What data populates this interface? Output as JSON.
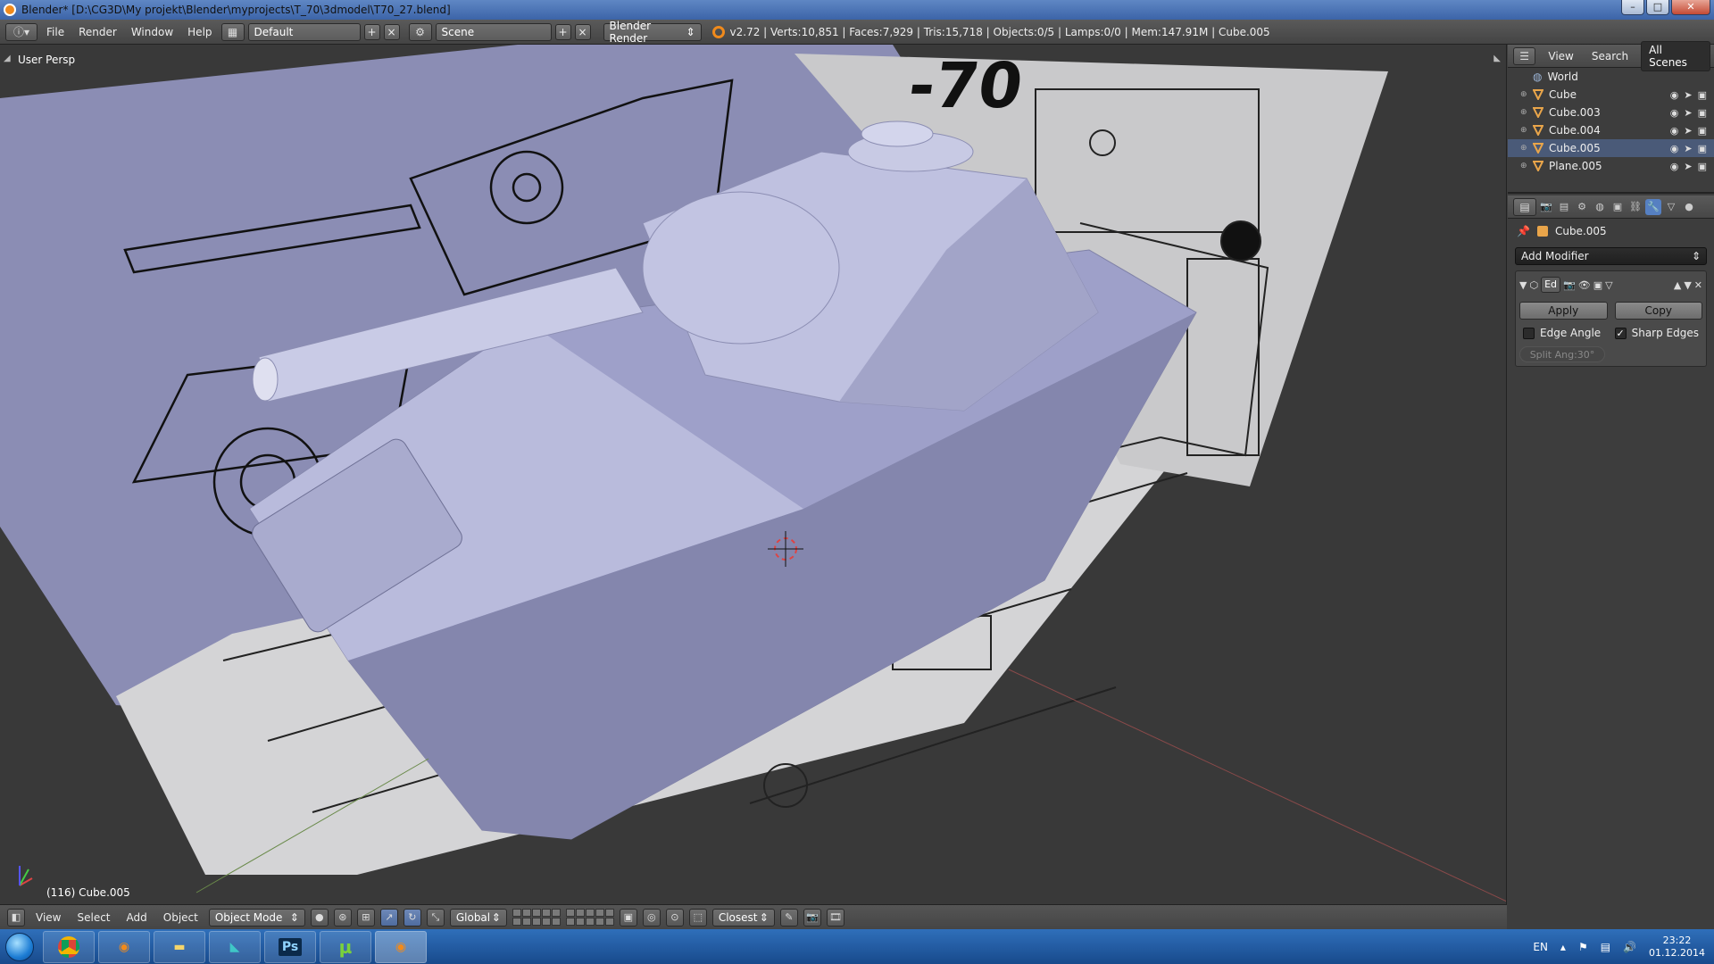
{
  "window": {
    "title": "Blender* [D:\\CG3D\\My projekt\\Blender\\myprojects\\T_70\\3dmodel\\T70_27.blend]",
    "minimize": "–",
    "maximize": "□",
    "close": "✕"
  },
  "header": {
    "menus": [
      "File",
      "Render",
      "Window",
      "Help"
    ],
    "layout": "Default",
    "scene": "Scene",
    "engine": "Blender Render",
    "stats": "v2.72 | Verts:10,851 | Faces:7,929 | Tris:15,718 | Objects:0/5 | Lamps:0/0 | Mem:147.91M | Cube.005"
  },
  "viewport": {
    "view_label": "User Persp",
    "object_label": "(116) Cube.005",
    "blueprint_text": "-70"
  },
  "footer": {
    "menus": [
      "View",
      "Select",
      "Add",
      "Object"
    ],
    "mode": "Object Mode",
    "orientation": "Global",
    "snap": "Closest"
  },
  "outliner": {
    "menus": [
      "View",
      "Search"
    ],
    "display": "All Scenes",
    "items": [
      {
        "name": "World",
        "type": "world"
      },
      {
        "name": "Cube",
        "type": "mesh"
      },
      {
        "name": "Cube.003",
        "type": "mesh"
      },
      {
        "name": "Cube.004",
        "type": "mesh"
      },
      {
        "name": "Cube.005",
        "type": "mesh"
      },
      {
        "name": "Plane.005",
        "type": "mesh"
      }
    ]
  },
  "properties": {
    "context_object": "Cube.005",
    "add_modifier": "Add Modifier",
    "modifier": {
      "name_short": "Ed",
      "apply": "Apply",
      "copy": "Copy",
      "edge_angle": "Edge Angle",
      "sharp_edges": "Sharp Edges",
      "split_angle": "Split Ang:30°"
    }
  },
  "taskbar": {
    "apps": [
      "Chrome",
      "Blender",
      "Explorer",
      "Max",
      "Ps",
      "uTorrent",
      "Blender"
    ],
    "lang": "EN",
    "time": "23:22",
    "date": "01.12.2014"
  },
  "colors": {
    "viewport_bg": "#393939",
    "model": "#9ea0c9",
    "accent": "#5680c2",
    "taskbar": "#1f5aa0"
  }
}
